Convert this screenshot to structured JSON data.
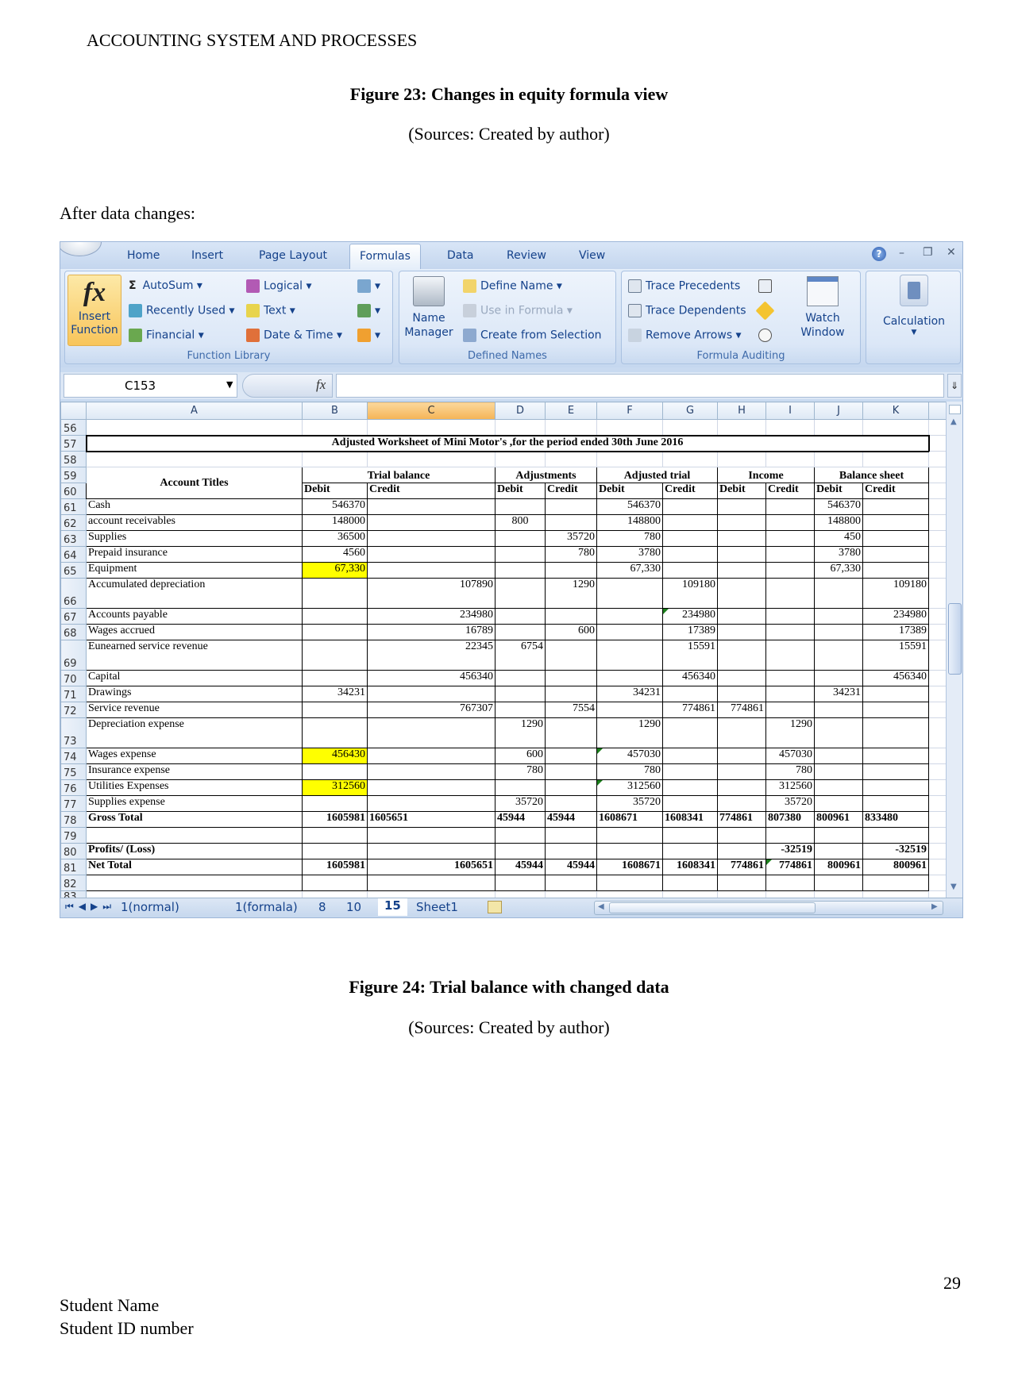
{
  "document": {
    "header": "ACCOUNTING SYSTEM AND PROCESSES",
    "figure23_title": "Figure 23: Changes in equity formula view",
    "figure23_source": "(Sources: Created by author)",
    "intro": "After data changes:",
    "figure24_title": "Figure 24: Trial balance with changed data",
    "figure24_source": "(Sources: Created by author)",
    "page_number": "29",
    "student_name": "Student Name",
    "student_id": "Student ID number"
  },
  "excel": {
    "tabs": [
      "Home",
      "Insert",
      "Page Layout",
      "Formulas",
      "Data",
      "Review",
      "View"
    ],
    "active_tab": "Formulas",
    "function_library": {
      "insert_function": [
        "Insert",
        "Function"
      ],
      "autosum": "AutoSum",
      "recently_used": "Recently Used",
      "financial": "Financial",
      "logical": "Logical",
      "text": "Text",
      "date_time": "Date & Time",
      "label": "Function Library"
    },
    "defined_names": {
      "name_manager": [
        "Name",
        "Manager"
      ],
      "define_name": "Define Name",
      "use_in_formula": "Use in Formula",
      "create_from_selection": "Create from Selection",
      "label": "Defined Names"
    },
    "formula_auditing": {
      "trace_precedents": "Trace Precedents",
      "trace_dependents": "Trace Dependents",
      "remove_arrows": "Remove Arrows",
      "watch_window": [
        "Watch",
        "Window"
      ],
      "label": "Formula Auditing"
    },
    "calculation": "Calculation",
    "name_box": "C153",
    "fx_label": "fx",
    "formula_value": "",
    "columns": [
      "A",
      "B",
      "C",
      "D",
      "E",
      "F",
      "G",
      "H",
      "I",
      "J",
      "K"
    ],
    "selected_column": "C",
    "worksheet_title": "Adjusted Worksheet of Mini Motor's ,for the period ended 30th June 2016",
    "account_titles_header": "Account Titles",
    "group_headers": [
      "Trial balance",
      "Adjustments",
      "Adjusted trial",
      "Income",
      "Balance sheet"
    ],
    "sub_headers": [
      "Debit",
      "Credit",
      "Debit",
      "Credit",
      "Debit",
      "Credit",
      "Debit",
      "Credit",
      "Debit",
      "Credit"
    ],
    "rows": [
      {
        "n": "56",
        "type": "blank"
      },
      {
        "n": "57",
        "type": "title"
      },
      {
        "n": "58",
        "type": "blank"
      },
      {
        "n": "59",
        "type": "group"
      },
      {
        "n": "60",
        "type": "sub"
      },
      {
        "n": "61",
        "cells": [
          "Cash",
          "546370",
          "",
          "",
          "",
          "546370",
          "",
          "",
          "",
          "546370",
          ""
        ]
      },
      {
        "n": "62",
        "cells": [
          "account receivables",
          "148000",
          "",
          "800",
          "",
          "148800",
          "",
          "",
          "",
          "148800",
          ""
        ]
      },
      {
        "n": "63",
        "cells": [
          "Supplies",
          "36500",
          "",
          "",
          "35720",
          "780",
          "",
          "",
          "",
          "450",
          ""
        ]
      },
      {
        "n": "64",
        "cells": [
          "Prepaid insurance",
          "4560",
          "",
          "",
          "780",
          "3780",
          "",
          "",
          "",
          "3780",
          ""
        ]
      },
      {
        "n": "65",
        "cells": [
          "Equipment",
          "67,330",
          "",
          "",
          "",
          "67,330",
          "",
          "",
          "",
          "67,330",
          ""
        ],
        "highlight": [
          "B"
        ]
      },
      {
        "n": "66",
        "tall": true,
        "cells": [
          "Accumulated depreciation",
          "",
          "107890",
          "",
          "1290",
          "",
          "109180",
          "",
          "",
          "",
          "109180"
        ]
      },
      {
        "n": "67",
        "cells": [
          "Accounts payable",
          "",
          "234980",
          "",
          "",
          "",
          "234980",
          "",
          "",
          "",
          "234980"
        ],
        "flag": [
          "G"
        ]
      },
      {
        "n": "68",
        "cells": [
          "Wages accrued",
          "",
          "16789",
          "",
          "600",
          "",
          "17389",
          "",
          "",
          "",
          "17389"
        ]
      },
      {
        "n": "69",
        "tall": true,
        "cells": [
          "Eunearned service revenue",
          "",
          "22345",
          "6754",
          "",
          "",
          "15591",
          "",
          "",
          "",
          "15591"
        ]
      },
      {
        "n": "70",
        "cells": [
          "Capital",
          "",
          "456340",
          "",
          "",
          "",
          "456340",
          "",
          "",
          "",
          "456340"
        ]
      },
      {
        "n": "71",
        "cells": [
          "Drawings",
          "34231",
          "",
          "",
          "",
          "34231",
          "",
          "",
          "",
          "34231",
          ""
        ]
      },
      {
        "n": "72",
        "cells": [
          "Service revenue",
          "",
          "767307",
          "",
          "7554",
          "",
          "774861",
          "774861",
          "",
          "",
          ""
        ]
      },
      {
        "n": "73",
        "tall": true,
        "cells": [
          "Depreciation expense",
          "",
          "",
          "1290",
          "",
          "1290",
          "",
          "",
          "1290",
          "",
          ""
        ]
      },
      {
        "n": "74",
        "cells": [
          "Wages expense",
          "456430",
          "",
          "600",
          "",
          "457030",
          "",
          "",
          "457030",
          "",
          ""
        ],
        "highlight": [
          "B"
        ],
        "flag": [
          "F"
        ]
      },
      {
        "n": "75",
        "cells": [
          "Insurance expense",
          "",
          "",
          "780",
          "",
          "780",
          "",
          "",
          "780",
          "",
          ""
        ]
      },
      {
        "n": "76",
        "cells": [
          "Utilities Expenses",
          "312560",
          "",
          "",
          "",
          "312560",
          "",
          "",
          "312560",
          "",
          ""
        ],
        "highlight": [
          "B"
        ],
        "flag": [
          "F"
        ]
      },
      {
        "n": "77",
        "cells": [
          "Supplies expense",
          "",
          "",
          "35720",
          "",
          "35720",
          "",
          "",
          "35720",
          "",
          ""
        ]
      },
      {
        "n": "78",
        "bold": true,
        "cells": [
          "Gross Total",
          "1605981",
          "1605651",
          "45944",
          "45944",
          "1608671",
          "1608341",
          "774861",
          "807380",
          "800961",
          "833480"
        ]
      },
      {
        "n": "79",
        "cells": [
          "",
          "",
          "",
          "",
          "",
          "",
          "",
          "",
          "",
          "",
          ""
        ]
      },
      {
        "n": "80",
        "bold": true,
        "cells": [
          "Profits/ (Loss)",
          "",
          "",
          "",
          "",
          "",
          "",
          "",
          "-32519",
          "",
          "-32519"
        ]
      },
      {
        "n": "81",
        "bold": true,
        "cells": [
          "Net Total",
          "1605981",
          "1605651",
          "45944",
          "45944",
          "1608671",
          "1608341",
          "774861",
          "774861",
          "800961",
          "800961"
        ],
        "flag": [
          "I"
        ]
      },
      {
        "n": "82",
        "cells": [
          "",
          "",
          "",
          "",
          "",
          "",
          "",
          "",
          "",
          "",
          ""
        ]
      },
      {
        "n": "83",
        "type": "blank",
        "partial": true
      }
    ],
    "sheet_tabs": [
      "1(normal)",
      "1(formala)",
      "8",
      "10",
      "15",
      "Sheet1"
    ],
    "active_sheet": "15",
    "colors": {
      "highlight": "#ffff00",
      "selected_column": "#f8c77b",
      "ribbon": "#dbe7f7",
      "accent_text": "#15428b"
    }
  }
}
